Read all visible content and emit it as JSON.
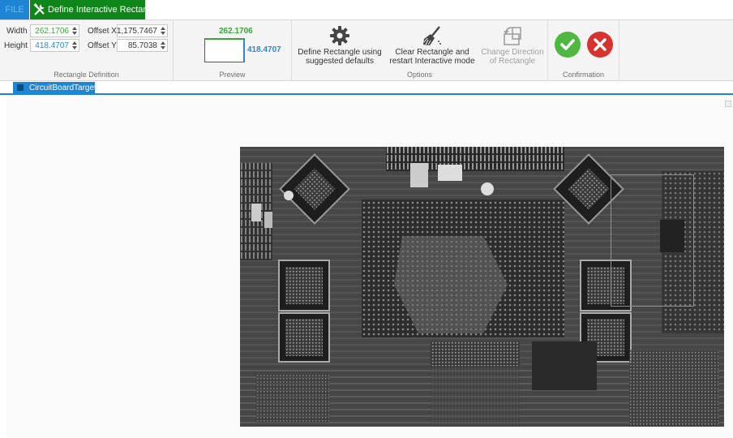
{
  "tabs": {
    "file": "FILE",
    "define": "Define Interactive Rectangle"
  },
  "rectangle_definition": {
    "width_label": "Width",
    "width_value": "262.1706",
    "height_label": "Height",
    "height_value": "418.4707",
    "offset_x_label": "Offset X",
    "offset_x_value": "1,175.7467",
    "offset_y_label": "Offset Y",
    "offset_y_value": "85.7038",
    "group_label": "Rectangle Definition"
  },
  "preview": {
    "width_text": "262.1706",
    "height_text": "418.4707",
    "group_label": "Preview"
  },
  "options": {
    "define_label": "Define Rectangle using suggested defaults",
    "clear_label": "Clear Rectangle and restart Interactive mode",
    "change_label": "Change Direction of Rectangle",
    "group_label": "Options"
  },
  "confirmation": {
    "group_label": "Confirmation"
  },
  "document": {
    "tab_label": "CircuitBoardTarget"
  },
  "icons": {
    "define_tab": "tools-icon",
    "define_rect": "gear-icon",
    "clear_rect": "broom-icon",
    "change_dir": "rotate-rectangle-icon",
    "ok": "checkmark-icon",
    "cancel": "close-icon"
  },
  "colors": {
    "accent_blue": "#1e84d4",
    "tab_green": "#10851a",
    "width_green": "#3aa53a",
    "height_blue": "#2c86d3",
    "ok_green": "#4fb840",
    "cancel_red": "#d6322e",
    "selection_green": "#2fd22f"
  }
}
